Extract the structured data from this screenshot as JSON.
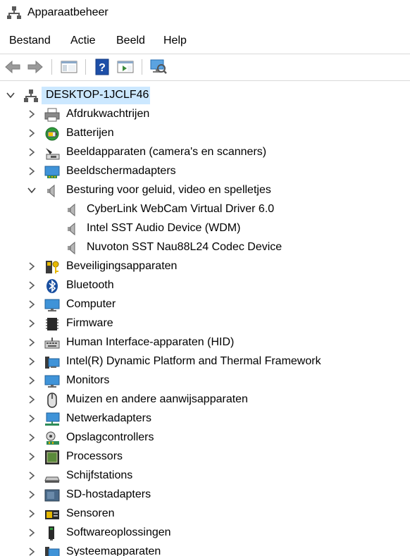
{
  "window": {
    "title": "Apparaatbeheer"
  },
  "menu": [
    "Bestand",
    "Actie",
    "Beeld",
    "Help"
  ],
  "toolbar": [
    "back",
    "forward",
    "show-hide-console-tree",
    "help",
    "properties",
    "scan-hardware"
  ],
  "tree": {
    "root": "DESKTOP-1JCLF46",
    "items": [
      {
        "label": "Afdrukwachtrijen",
        "icon": "printer-icon",
        "expanded": false
      },
      {
        "label": "Batterijen",
        "icon": "battery-icon",
        "expanded": false
      },
      {
        "label": "Beeldapparaten (camera's en scanners)",
        "icon": "camera-icon",
        "expanded": false
      },
      {
        "label": "Beeldschermadapters",
        "icon": "display-adapter-icon",
        "expanded": false
      },
      {
        "label": "Besturing voor geluid, video en spelletjes",
        "icon": "speaker-icon",
        "expanded": true,
        "children": [
          "CyberLink WebCam Virtual Driver 6.0",
          "Intel SST Audio Device (WDM)",
          "Nuvoton SST Nau88L24 Codec Device"
        ]
      },
      {
        "label": "Beveiligingsapparaten",
        "icon": "security-key-icon",
        "expanded": false
      },
      {
        "label": "Bluetooth",
        "icon": "bluetooth-icon",
        "expanded": false
      },
      {
        "label": "Computer",
        "icon": "computer-icon",
        "expanded": false
      },
      {
        "label": "Firmware",
        "icon": "chip-icon",
        "expanded": false
      },
      {
        "label": "Human Interface-apparaten (HID)",
        "icon": "hid-icon",
        "expanded": false
      },
      {
        "label": "Intel(R) Dynamic Platform and Thermal Framework",
        "icon": "system-device-icon",
        "expanded": false
      },
      {
        "label": "Monitors",
        "icon": "monitor-icon",
        "expanded": false
      },
      {
        "label": "Muizen en andere aanwijsapparaten",
        "icon": "mouse-icon",
        "expanded": false
      },
      {
        "label": "Netwerkadapters",
        "icon": "network-icon",
        "expanded": false
      },
      {
        "label": "Opslagcontrollers",
        "icon": "storage-controller-icon",
        "expanded": false
      },
      {
        "label": "Processors",
        "icon": "processor-icon",
        "expanded": false
      },
      {
        "label": "Schijfstations",
        "icon": "disk-drive-icon",
        "expanded": false
      },
      {
        "label": "SD-hostadapters",
        "icon": "sd-host-icon",
        "expanded": false
      },
      {
        "label": "Sensoren",
        "icon": "sensor-icon",
        "expanded": false
      },
      {
        "label": "Softwareoplossingen",
        "icon": "software-icon",
        "expanded": false
      },
      {
        "label": "Systeemapparaten",
        "icon": "system-device-icon",
        "expanded": false
      }
    ]
  },
  "colors": {
    "selection": "#cce8ff",
    "chevron": "#5a5a5a"
  }
}
